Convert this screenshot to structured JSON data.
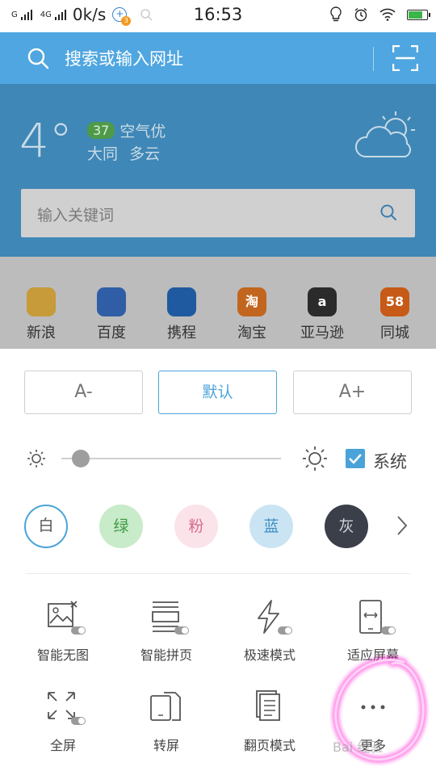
{
  "status_bar": {
    "network1": "G",
    "network2": "4G",
    "speed": "0k/s",
    "notif_badge": "3",
    "time": "16:53",
    "battery_level": 0.8
  },
  "header": {
    "placeholder": "搜索或输入网址"
  },
  "weather": {
    "temperature": "4°",
    "aqi": "37",
    "air_quality": "空气优",
    "city": "大同",
    "condition": "多云",
    "keyword_placeholder": "输入关键词"
  },
  "quick_links": [
    {
      "label": "新浪",
      "icon_text": "",
      "icon": "sina-icon",
      "color": "#c79a3a"
    },
    {
      "label": "百度",
      "icon_text": "",
      "icon": "baidu-icon",
      "color": "#2f5ea6"
    },
    {
      "label": "携程",
      "icon_text": "",
      "icon": "ctrip-icon",
      "color": "#1f5aa0"
    },
    {
      "label": "淘宝",
      "icon_text": "淘",
      "icon": "taobao-icon",
      "color": "#c2661f"
    },
    {
      "label": "亚马逊",
      "icon_text": "a",
      "icon": "amazon-icon",
      "color": "#2b2b2b"
    },
    {
      "label": "同城",
      "icon_text": "58",
      "icon": "58-icon",
      "color": "#c75a16"
    }
  ],
  "font_size": {
    "decrease": "A-",
    "default": "默认",
    "increase": "A+"
  },
  "brightness": {
    "level": 0.09,
    "system_label": "系统",
    "system_checked": true
  },
  "themes": [
    {
      "label": "白",
      "bg": "#ffffff",
      "fg": "#555555",
      "selected": true
    },
    {
      "label": "绿",
      "bg": "#c8ebc9",
      "fg": "#3e9a45",
      "selected": false
    },
    {
      "label": "粉",
      "bg": "#fbe3ea",
      "fg": "#d76b8a",
      "selected": false
    },
    {
      "label": "蓝",
      "bg": "#cbe4f3",
      "fg": "#3d8fc4",
      "selected": false
    },
    {
      "label": "灰",
      "bg": "#3a3f4a",
      "fg": "#d0d4da",
      "selected": false
    }
  ],
  "options": [
    {
      "label": "智能无图",
      "icon": "no-image-icon"
    },
    {
      "label": "智能拼页",
      "icon": "page-merge-icon"
    },
    {
      "label": "极速模式",
      "icon": "lightning-icon"
    },
    {
      "label": "适应屏幕",
      "icon": "fit-screen-icon"
    },
    {
      "label": "全屏",
      "icon": "fullscreen-icon"
    },
    {
      "label": "转屏",
      "icon": "rotate-screen-icon"
    },
    {
      "label": "翻页模式",
      "icon": "page-turn-icon"
    },
    {
      "label": "更多",
      "icon": "more-icon"
    }
  ],
  "watermark": "Bai 经验",
  "colors": {
    "accent": "#4aa3d8",
    "header": "#4fa6e0",
    "highlight": "#ff2bd6"
  }
}
